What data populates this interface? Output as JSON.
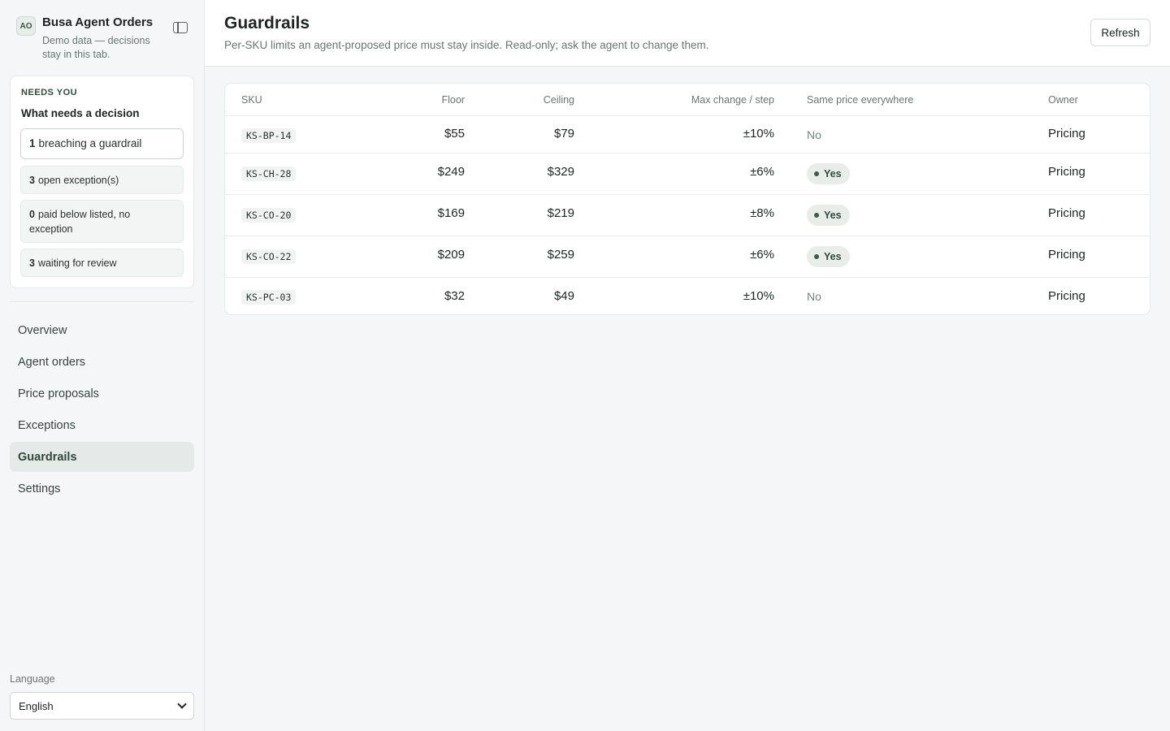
{
  "brand": {
    "initials": "AO",
    "title": "Busa Agent Orders",
    "subtitle": "Demo data — decisions stay in this tab."
  },
  "icons": {
    "sidebar_toggle": "sidebar-toggle-icon",
    "select_chevron": "chevron-down-icon"
  },
  "needs_you": {
    "kicker": "NEEDS YOU",
    "title": "What needs a decision",
    "items": [
      {
        "count": "1",
        "label": "breaching a guardrail"
      },
      {
        "count": "3",
        "label": "open exception(s)"
      },
      {
        "count": "0",
        "label": "paid below listed, no exception"
      },
      {
        "count": "3",
        "label": "waiting for review"
      }
    ]
  },
  "nav": {
    "items": [
      {
        "label": "Overview"
      },
      {
        "label": "Agent orders"
      },
      {
        "label": "Price proposals"
      },
      {
        "label": "Exceptions"
      },
      {
        "label": "Guardrails"
      },
      {
        "label": "Settings"
      }
    ],
    "active": "Guardrails"
  },
  "language": {
    "label": "Language",
    "selected": "English"
  },
  "header": {
    "title": "Guardrails",
    "subtitle": "Per-SKU limits an agent-proposed price must stay inside. Read-only; ask the agent to change them.",
    "refresh_label": "Refresh"
  },
  "table": {
    "columns": [
      "SKU",
      "Floor",
      "Ceiling",
      "Max change / step",
      "Same price everywhere",
      "Owner"
    ],
    "rows": [
      {
        "sku": "KS-BP-14",
        "floor": "$55",
        "ceiling": "$79",
        "max_change": "±10%",
        "same_price": "No",
        "owner": "Pricing"
      },
      {
        "sku": "KS-CH-28",
        "floor": "$249",
        "ceiling": "$329",
        "max_change": "±6%",
        "same_price": "Yes",
        "owner": "Pricing"
      },
      {
        "sku": "KS-CO-20",
        "floor": "$169",
        "ceiling": "$219",
        "max_change": "±8%",
        "same_price": "Yes",
        "owner": "Pricing"
      },
      {
        "sku": "KS-CO-22",
        "floor": "$209",
        "ceiling": "$259",
        "max_change": "±6%",
        "same_price": "Yes",
        "owner": "Pricing"
      },
      {
        "sku": "KS-PC-03",
        "floor": "$32",
        "ceiling": "$49",
        "max_change": "±10%",
        "same_price": "No",
        "owner": "Pricing"
      }
    ]
  },
  "colors": {
    "accent": "#2f4b3d",
    "background": "#f4f6f7",
    "yes_pill": "#e8ede9"
  }
}
